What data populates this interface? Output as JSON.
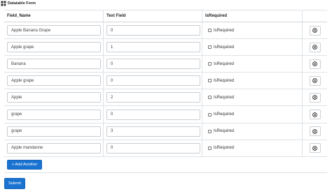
{
  "form": {
    "title": "Datatable Form",
    "colors": {
      "primary": "#1a73d1",
      "border": "#dee2e6"
    }
  },
  "table": {
    "headers": [
      "Field_Name",
      "Text Field",
      "IsRequired",
      ""
    ],
    "rows": [
      {
        "field_name": "Apple Banana Grape",
        "text_field": "0",
        "required_label": "IsRequired",
        "required": false
      },
      {
        "field_name": "Apple grape",
        "text_field": "1",
        "required_label": "IsRequired",
        "required": false
      },
      {
        "field_name": "Banana",
        "text_field": "0",
        "required_label": "IsRequired",
        "required": false
      },
      {
        "field_name": "Apple grape",
        "text_field": "0",
        "required_label": "IsRequired",
        "required": false
      },
      {
        "field_name": "Apple",
        "text_field": "2",
        "required_label": "IsRequired",
        "required": false
      },
      {
        "field_name": "grape",
        "text_field": "0",
        "required_label": "IsRequired",
        "required": false
      },
      {
        "field_name": "grape",
        "text_field": "3",
        "required_label": "IsRequired",
        "required": false
      },
      {
        "field_name": "Apple mandanne",
        "text_field": "0",
        "required_label": "IsRequired",
        "required": false
      }
    ],
    "remove_icon": "circle-x-icon"
  },
  "actions": {
    "add_label": "+ Add Another",
    "submit_label": "Submit"
  }
}
